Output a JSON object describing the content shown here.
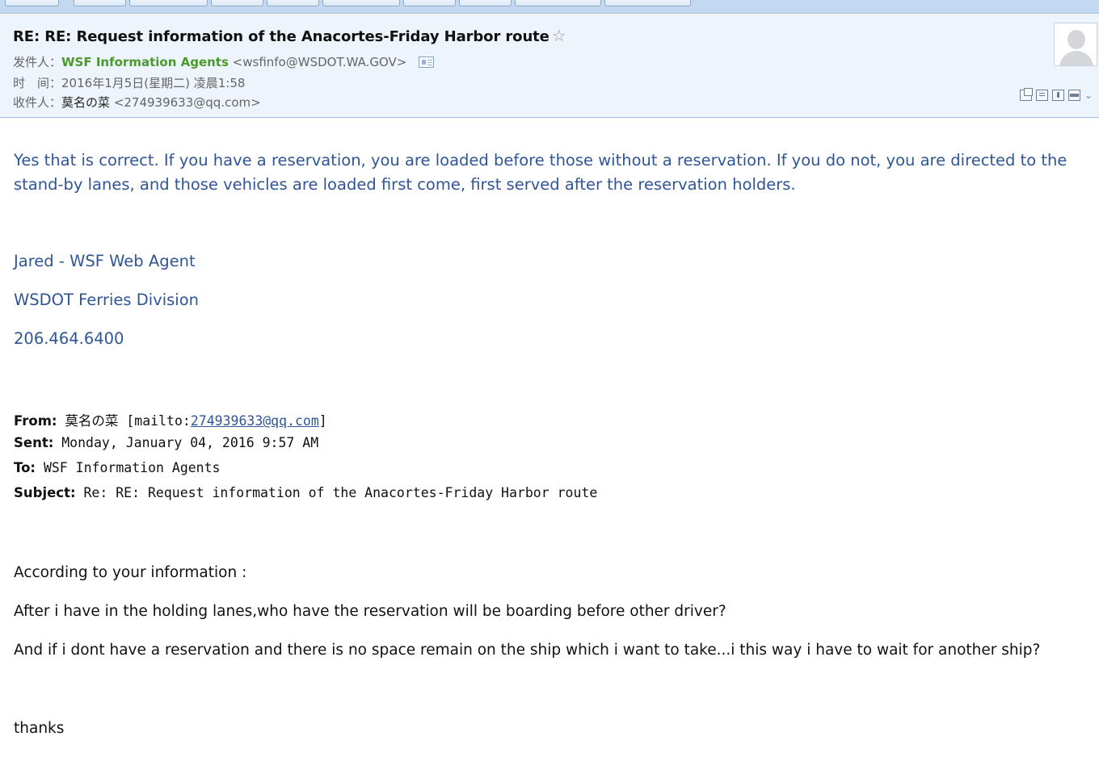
{
  "toolbar": {
    "buttons": [
      "",
      "",
      "",
      "",
      "",
      "",
      "",
      "",
      "",
      ""
    ]
  },
  "header": {
    "subject": "RE: RE: Request information of the Anacortes-Friday Harbor route",
    "star_icon": "star-outline-icon",
    "from_label": "发件人：",
    "from_name": "WSF Information Agents",
    "from_email": "<wsfinfo@WSDOT.WA.GOV>",
    "time_label": "时　间：",
    "time_value": "2016年1月5日(星期二) 凌晨1:58",
    "to_label": "收件人：",
    "to_name": "莫名の菜",
    "to_email": "<274939633@qq.com>",
    "tool_icons": [
      "new-window-icon",
      "note-icon",
      "save-icon",
      "print-icon",
      "chevron-down-icon"
    ]
  },
  "body": {
    "reply_text": "Yes that is correct.  If you have a reservation, you are loaded before those without a reservation.  If you do not, you are directed to the stand-by lanes, and those vehicles are loaded first come, first served after the reservation holders.",
    "signature": {
      "name": "Jared - WSF Web Agent",
      "division": "WSDOT Ferries Division",
      "phone": "206.464.6400"
    },
    "quoted_header": {
      "from_label": "From:",
      "from_name": "莫名の菜",
      "mailto_prefix": "[mailto:",
      "mailto_email": "274939633@qq.com",
      "mailto_suffix": "]",
      "sent_label": "Sent:",
      "sent_value": "Monday, January 04, 2016 9:57 AM",
      "to_label": "To:",
      "to_value": "WSF Information Agents",
      "subject_label": "Subject:",
      "subject_value": "Re: RE: Request information of the Anacortes-Friday Harbor route"
    },
    "original": {
      "line1": "According to your information :",
      "line2": "After i have in the holding lanes,who have the reservation will be boarding before other driver?",
      "line3": "And if i dont have a reservation and there is no space remain on the ship which i want to take...i this way i have to wait for another ship?",
      "closing": "thanks"
    }
  }
}
